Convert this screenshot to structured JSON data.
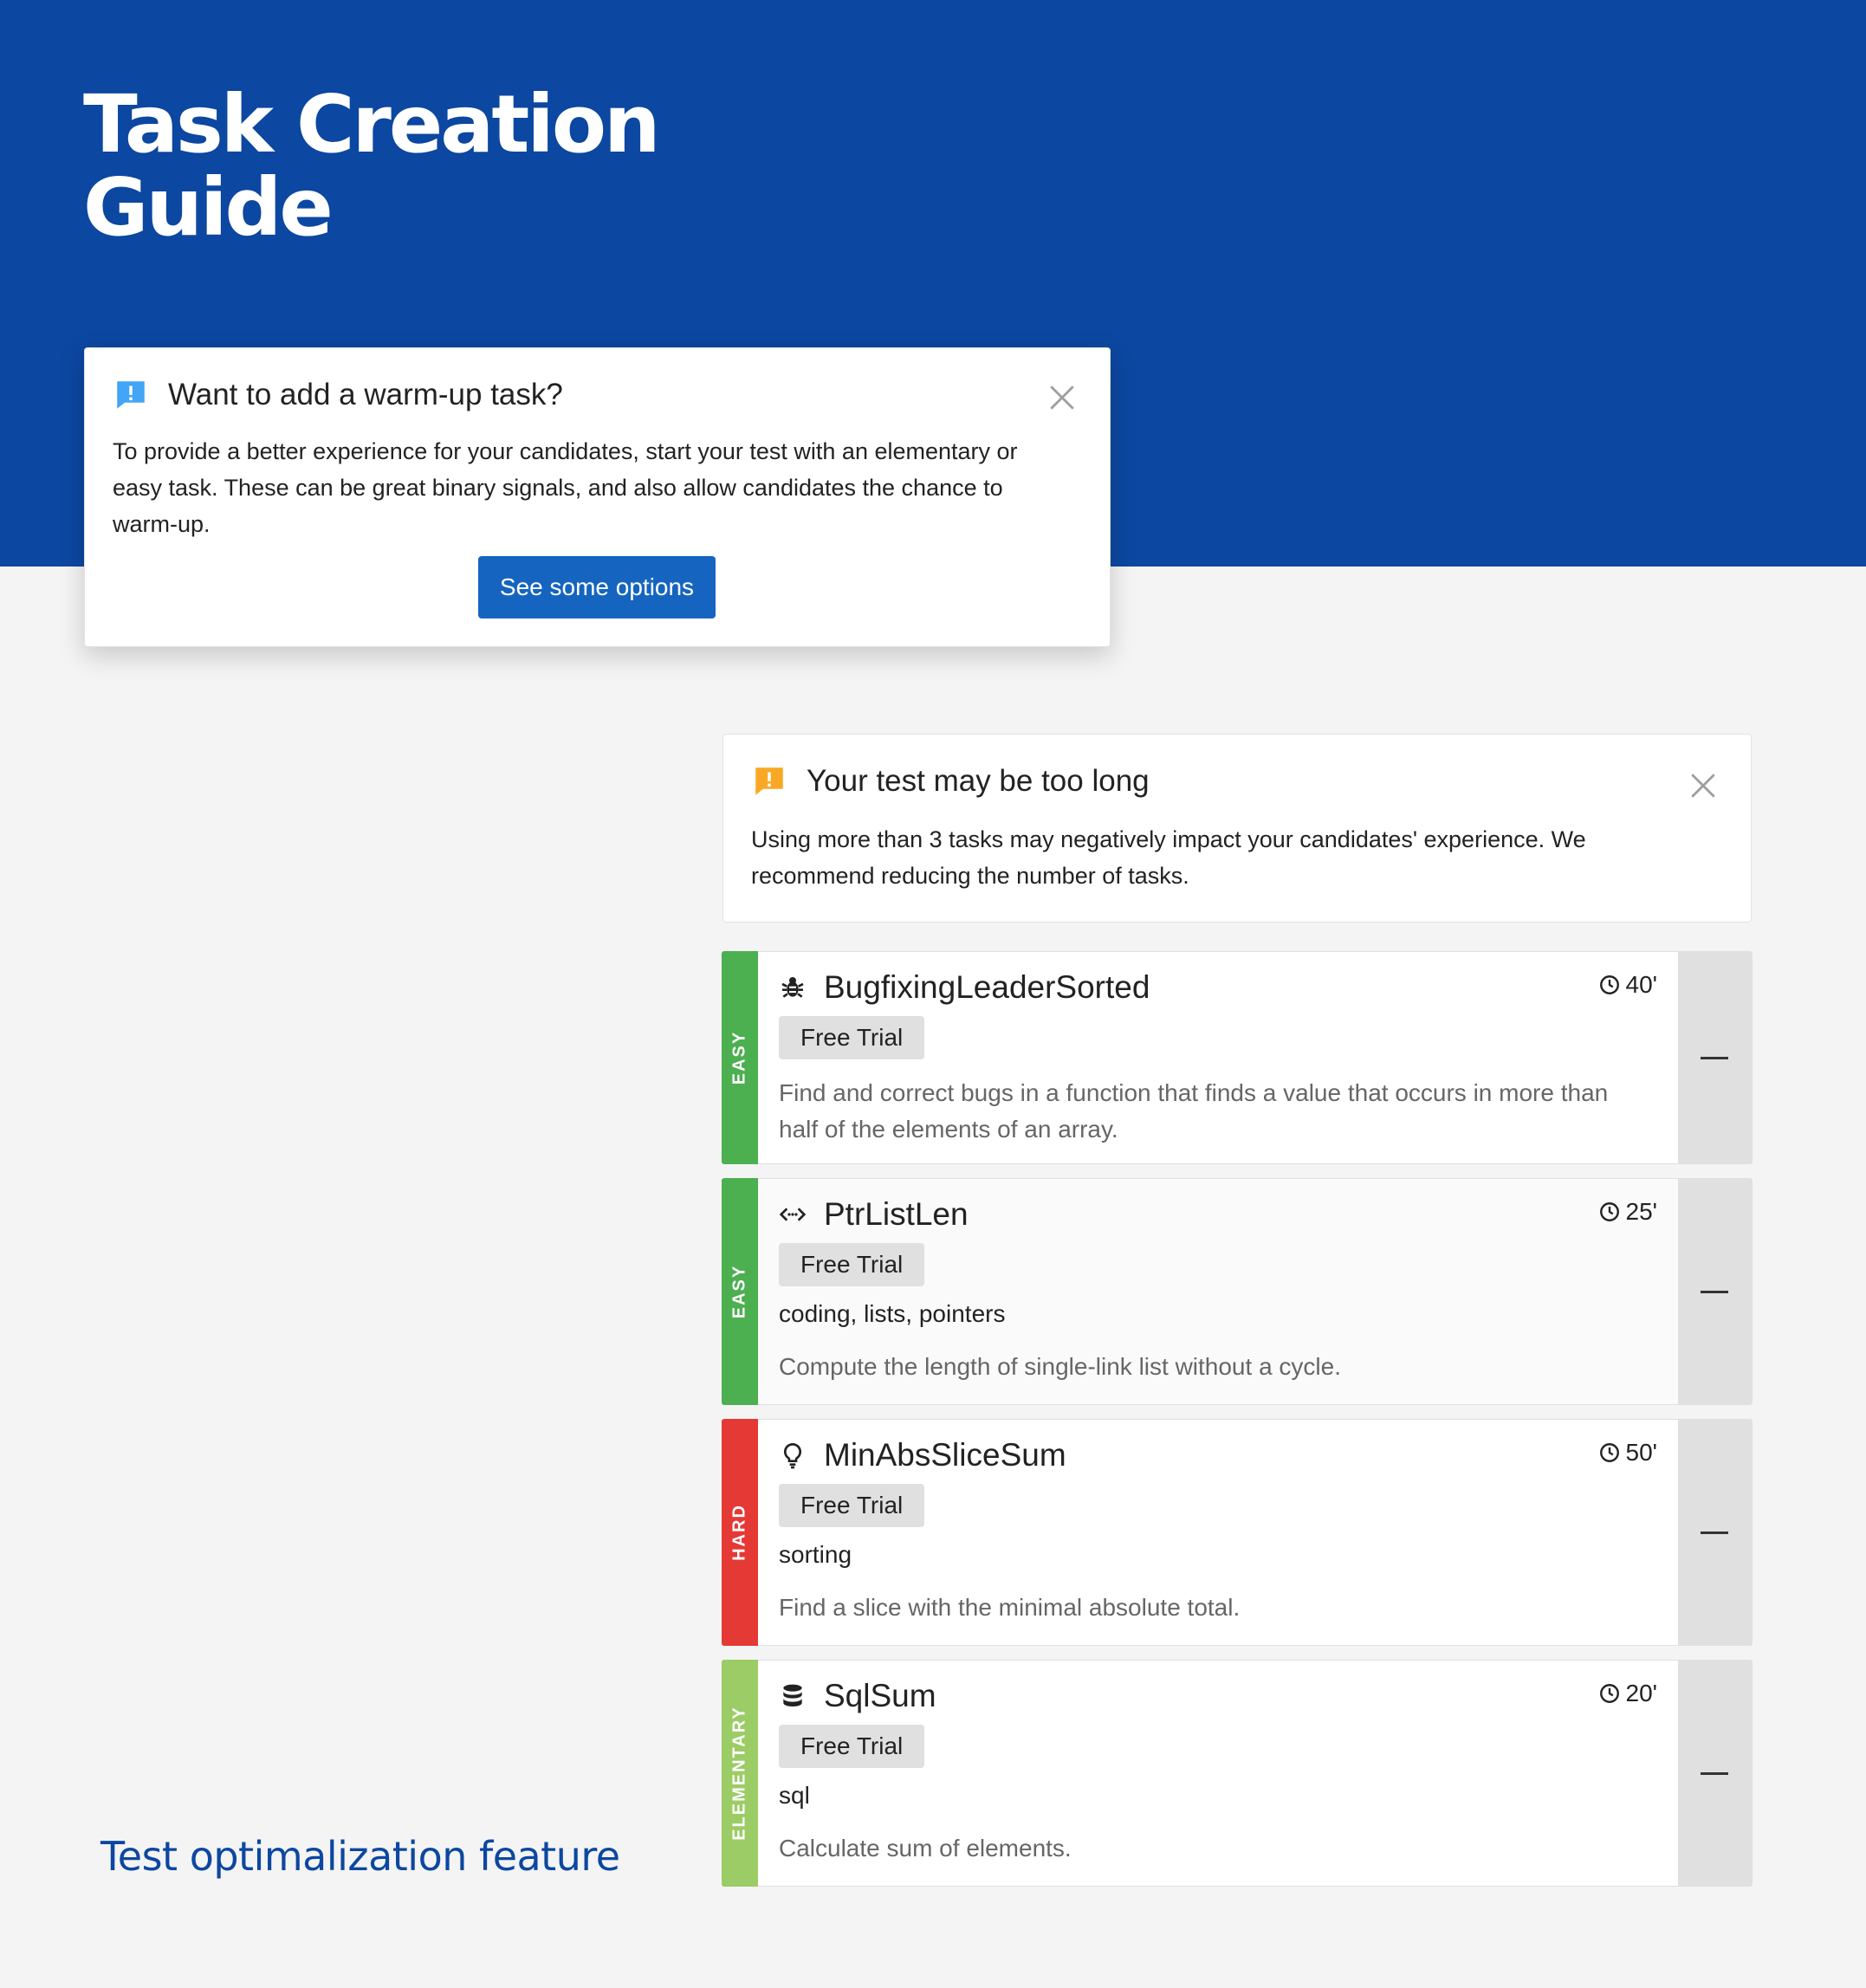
{
  "hero": {
    "title_line1": "Task Creation",
    "title_line2": "Guide",
    "background": "#0c47a1"
  },
  "warmup_notice": {
    "icon": "info-chat-icon",
    "icon_color": "#42a5f5",
    "title": "Want to add a warm-up task?",
    "body": "To provide a better experience for your candidates, start your test with an elementary or easy task. These can be great binary signals, and also allow candidates the chance to warm-up.",
    "button_label": "See some options",
    "close_icon": "close-icon"
  },
  "length_notice": {
    "icon": "warning-chat-icon",
    "icon_color": "#f9a825",
    "title": "Your test may be too long",
    "body": "Using more than 3 tasks may negatively impact your candidates' experience. We recommend reducing the number of tasks.",
    "close_icon": "close-icon"
  },
  "tasks": [
    {
      "difficulty": "EASY",
      "difficulty_color": "#4caf50",
      "icon": "bug-icon",
      "name": "BugfixingLeaderSorted",
      "time": "40'",
      "badge": "Free Trial",
      "tags": "",
      "description": "Find and correct bugs in a function that finds a value that occurs in more than half of the elements of an array."
    },
    {
      "difficulty": "EASY",
      "difficulty_color": "#4caf50",
      "icon": "code-icon",
      "name": "PtrListLen",
      "time": "25'",
      "badge": "Free Trial",
      "tags": "coding, lists, pointers",
      "description": "Compute the length of single-link list without a cycle."
    },
    {
      "difficulty": "HARD",
      "difficulty_color": "#e53935",
      "icon": "lightbulb-icon",
      "name": "MinAbsSliceSum",
      "time": "50'",
      "badge": "Free Trial",
      "tags": "sorting",
      "description": "Find a slice with the minimal absolute total."
    },
    {
      "difficulty": "ELEMENTARY",
      "difficulty_color": "#9ccc65",
      "icon": "database-icon",
      "name": "SqlSum",
      "time": "20'",
      "badge": "Free Trial",
      "tags": "sql",
      "description": "Calculate sum of elements."
    }
  ],
  "feature_caption": "Test optimalization feature",
  "accent_color": "#1565c0"
}
